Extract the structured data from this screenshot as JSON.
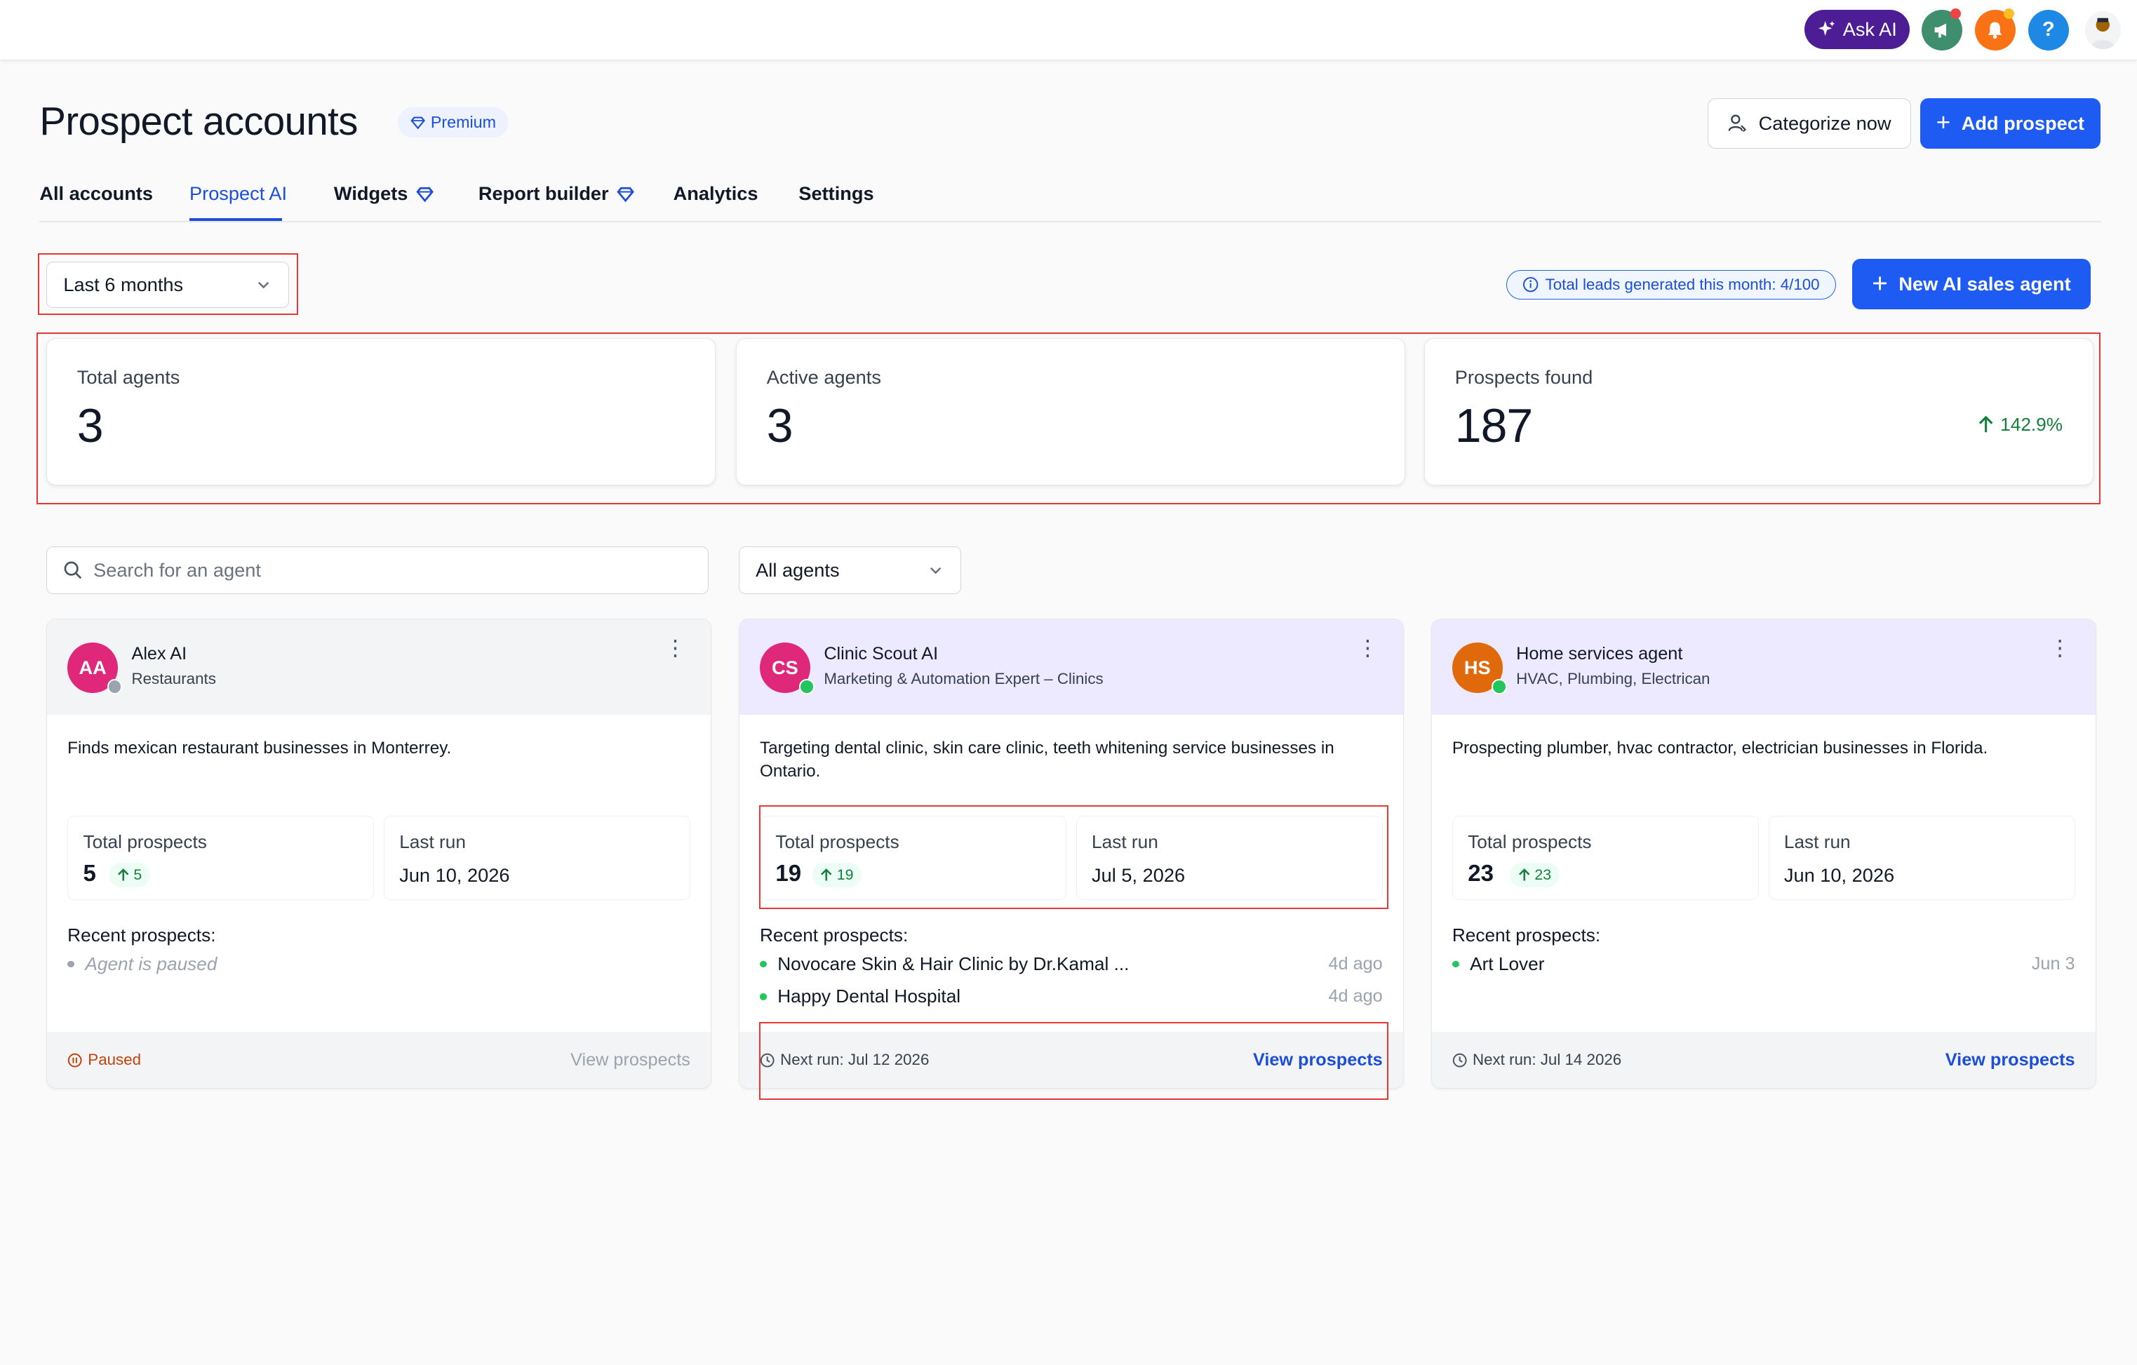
{
  "topbar": {
    "ask_ai_label": "Ask AI",
    "icons": [
      "sparkles-icon",
      "megaphone-icon",
      "bell-icon",
      "help-icon",
      "user-avatar"
    ],
    "colors": {
      "ask_ai_bg": "#4c1d95",
      "megaphone_bg": "#3f8f6f",
      "bell_bg": "#f97316",
      "help_bg": "#1e88e5"
    }
  },
  "header": {
    "title": "Prospect accounts",
    "premium_badge": "Premium",
    "categorize_label": "Categorize now",
    "add_prospect_label": "Add prospect"
  },
  "tabs": [
    {
      "label": "All accounts",
      "active": false
    },
    {
      "label": "Prospect AI",
      "active": true
    },
    {
      "label": "Widgets",
      "active": false,
      "premium": true
    },
    {
      "label": "Report builder",
      "active": false,
      "premium": true
    },
    {
      "label": "Analytics",
      "active": false
    },
    {
      "label": "Settings",
      "active": false
    }
  ],
  "filters": {
    "period_selected": "Last 6 months",
    "leads_info": "Total leads generated this month: 4/100",
    "new_agent_label": "New AI sales agent"
  },
  "stats": [
    {
      "label": "Total agents",
      "value": "3"
    },
    {
      "label": "Active agents",
      "value": "3"
    },
    {
      "label": "Prospects found",
      "value": "187",
      "change": "142.9%"
    }
  ],
  "agent_filters": {
    "search_placeholder": "Search for an agent",
    "agent_type_selected": "All agents"
  },
  "agents": [
    {
      "initials": "AA",
      "name": "Alex AI",
      "subtitle": "Restaurants",
      "avatar_color": "#e0287a",
      "status": "paused",
      "description": "Finds mexican restaurant businesses in Monterrey.",
      "total_prospects_label": "Total prospects",
      "total_prospects": "5",
      "total_prospects_change": "5",
      "last_run_label": "Last run",
      "last_run": "Jun 10, 2026",
      "recent_label": "Recent prospects:",
      "recent_paused": "Agent is paused",
      "footer_text": "Paused",
      "view_label": "View prospects"
    },
    {
      "initials": "CS",
      "name": "Clinic Scout AI",
      "subtitle": "Marketing & Automation Expert – Clinics",
      "avatar_color": "#e0287a",
      "status": "active",
      "description": "Targeting dental clinic, skin care clinic, teeth whitening service businesses in Ontario.",
      "total_prospects_label": "Total prospects",
      "total_prospects": "19",
      "total_prospects_change": "19",
      "last_run_label": "Last run",
      "last_run": "Jul 5, 2026",
      "recent_label": "Recent prospects:",
      "recent": [
        {
          "name": "Novocare Skin & Hair Clinic by Dr.Kamal ...",
          "when": "4d ago"
        },
        {
          "name": "Happy Dental Hospital",
          "when": "4d ago"
        }
      ],
      "footer_text": "Next run: Jul 12 2026",
      "view_label": "View prospects"
    },
    {
      "initials": "HS",
      "name": "Home services agent",
      "subtitle": "HVAC, Plumbing, Electrican",
      "avatar_color": "#e06a0b",
      "status": "active",
      "description": "Prospecting plumber, hvac contractor, electrician businesses in Florida.",
      "total_prospects_label": "Total prospects",
      "total_prospects": "23",
      "total_prospects_change": "23",
      "last_run_label": "Last run",
      "last_run": "Jun 10, 2026",
      "recent_label": "Recent prospects:",
      "recent": [
        {
          "name": "Art Lover",
          "when": "Jun 3"
        }
      ],
      "footer_text": "Next run: Jul 14 2026",
      "view_label": "View prospects"
    }
  ]
}
